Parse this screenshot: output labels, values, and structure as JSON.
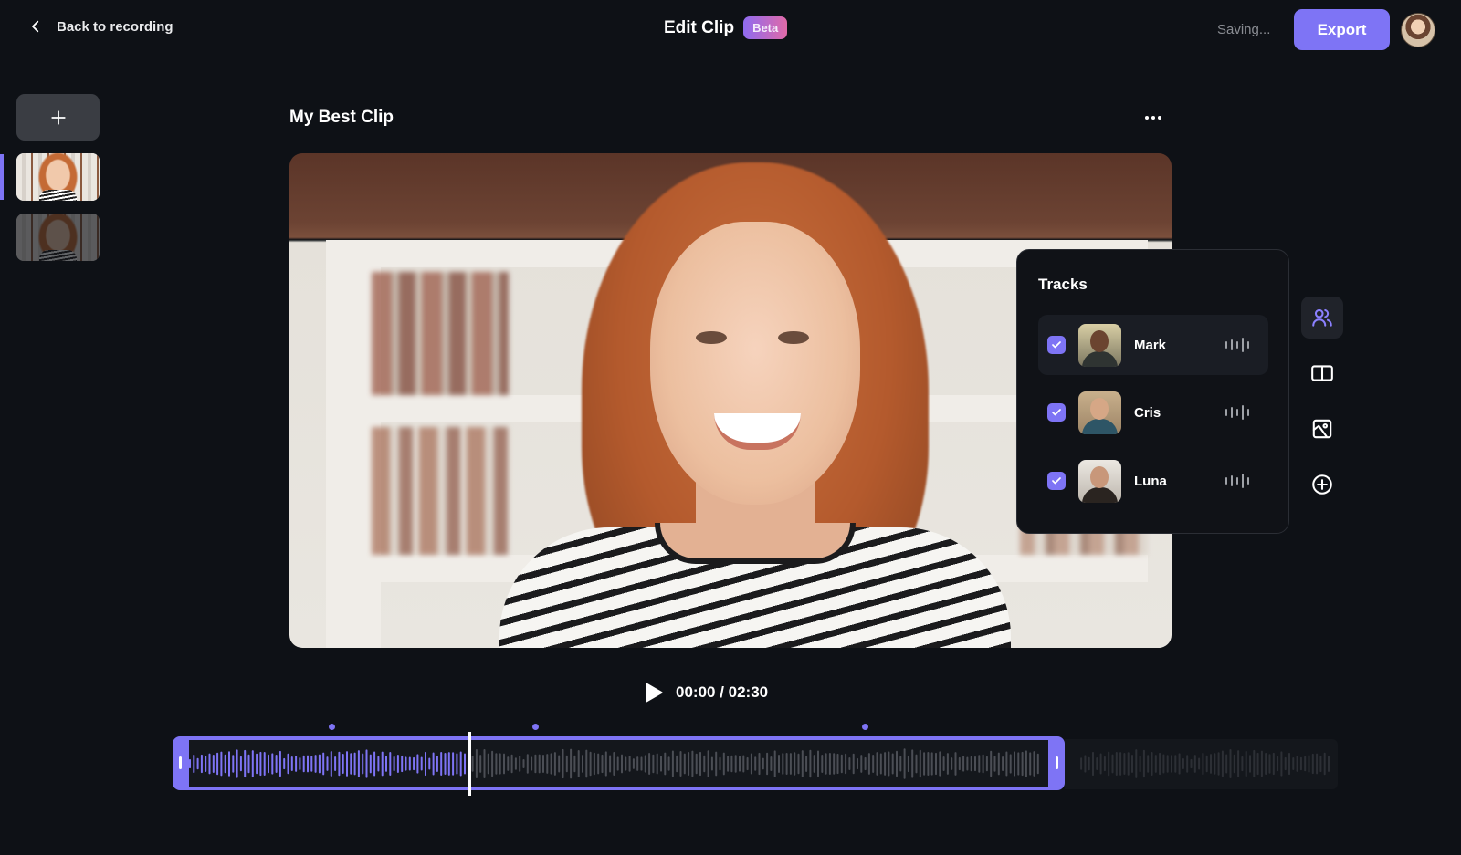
{
  "header": {
    "back_label": "Back to recording",
    "title": "Edit Clip",
    "badge": "Beta",
    "status": "Saving...",
    "export_label": "Export"
  },
  "sidebar": {
    "add_clip_icon": "plus-icon",
    "clips": [
      {
        "selected": true
      },
      {
        "selected": false
      }
    ]
  },
  "clip": {
    "title": "My Best Clip",
    "more_icon": "more-horizontal-icon"
  },
  "tracks_panel": {
    "title": "Tracks",
    "tracks": [
      {
        "name": "Mark",
        "checked": true,
        "active": true
      },
      {
        "name": "Cris",
        "checked": true,
        "active": false
      },
      {
        "name": "Luna",
        "checked": true,
        "active": false
      }
    ]
  },
  "toolbar": {
    "tools": [
      {
        "name": "people-icon",
        "active": true
      },
      {
        "name": "layout-split-icon",
        "active": false
      },
      {
        "name": "image-icon",
        "active": false
      },
      {
        "name": "add-circle-icon",
        "active": false
      }
    ]
  },
  "player": {
    "time": "00:00 / 02:30",
    "current": "00:00",
    "duration": "02:30"
  },
  "timeline": {
    "playhead_fraction": 0.254,
    "selection_end_fraction": 0.763,
    "marker_fractions": [
      0.136,
      0.311,
      0.594
    ],
    "accent": "#7e74f5"
  },
  "colors": {
    "background": "#0e1116",
    "accent": "#7e74f5",
    "panel": "#101217"
  }
}
